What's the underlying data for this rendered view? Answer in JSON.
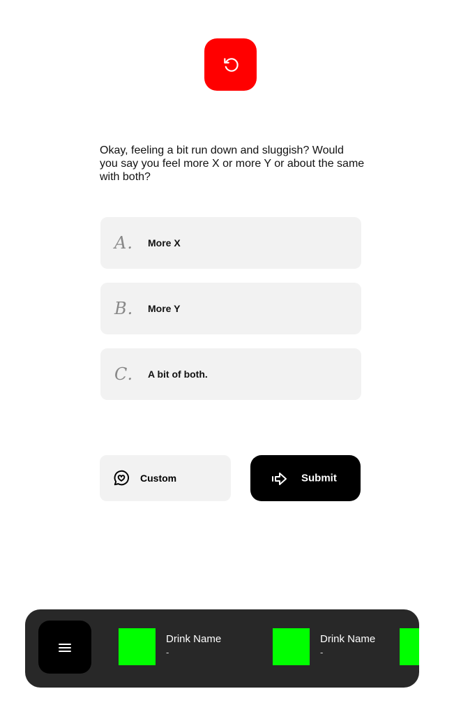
{
  "question": {
    "text": "Okay, feeling a bit run down and sluggish? Would you say you feel more X or more Y or about the same with both?"
  },
  "options": [
    {
      "letter": "A.",
      "label": "More X"
    },
    {
      "letter": "B.",
      "label": "More Y"
    },
    {
      "letter": "C.",
      "label": "A bit of both."
    }
  ],
  "actions": {
    "custom_label": "Custom",
    "submit_label": "Submit"
  },
  "bottom_bar": {
    "drinks": [
      {
        "name": "Drink Name",
        "subtitle": "-"
      },
      {
        "name": "Drink Name",
        "subtitle": "-"
      },
      {
        "name": "",
        "subtitle": ""
      }
    ]
  },
  "colors": {
    "reset_button": "#ff0000",
    "option_bg": "#f2f2f2",
    "submit_bg": "#000000",
    "bar_bg": "#282828",
    "drink_swatch": "#00ff00"
  },
  "icons": {
    "reset": "rotate-ccw-icon",
    "custom": "message-heart-icon",
    "submit": "arrow-right-icon",
    "menu": "hamburger-menu-icon"
  }
}
